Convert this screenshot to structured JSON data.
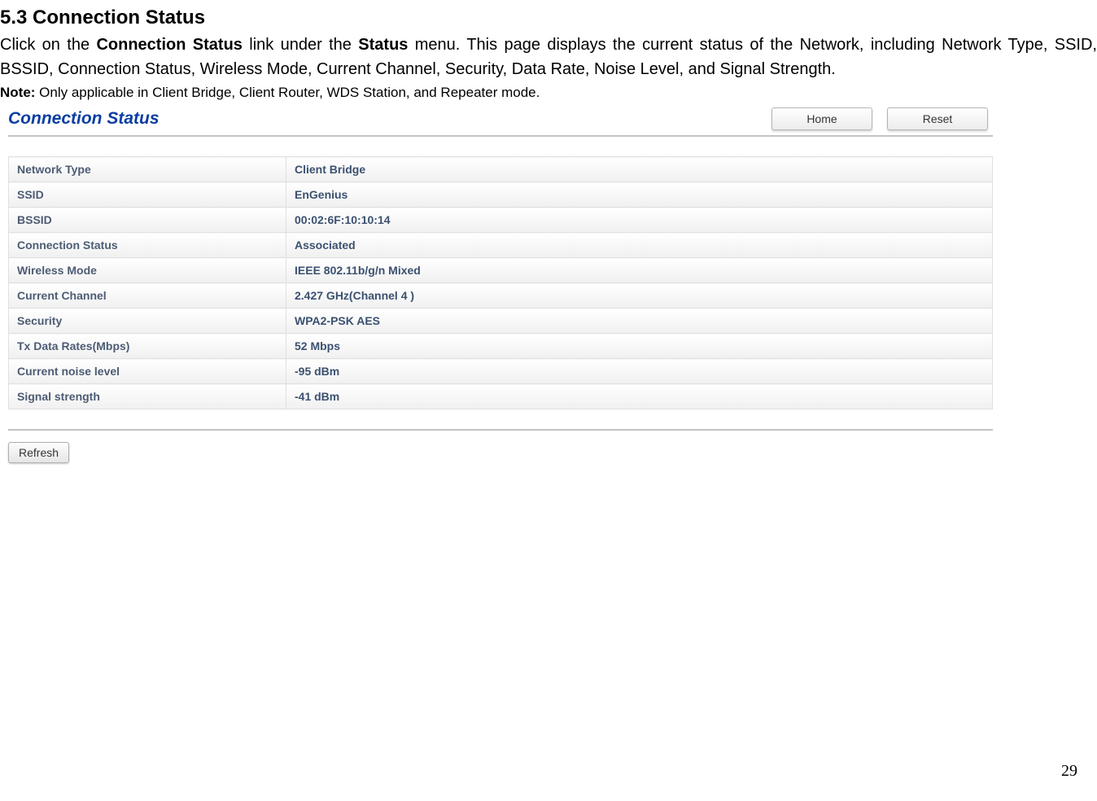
{
  "doc": {
    "section_heading": "5.3   Connection Status",
    "para_parts": {
      "p1a": "Click on the ",
      "p1b": "Connection Status",
      "p1c": " link under the ",
      "p1d": "Status",
      "p1e": " menu. This page displays the current status of the Network, including Network Type, SSID, BSSID, Connection Status, Wireless Mode, Current Channel, Security, Data Rate, Noise Level, and Signal Strength."
    },
    "note_label": "Note:",
    "note_text": " Only applicable in Client Bridge, Client Router, WDS Station, and Repeater mode.",
    "page_number": "29"
  },
  "ui": {
    "title": "Connection Status",
    "buttons": {
      "home": "Home",
      "reset": "Reset"
    },
    "rows": [
      {
        "label": "Network Type",
        "value": "Client Bridge"
      },
      {
        "label": "SSID",
        "value": "EnGenius"
      },
      {
        "label": "BSSID",
        "value": "00:02:6F:10:10:14"
      },
      {
        "label": "Connection Status",
        "value": "Associated"
      },
      {
        "label": "Wireless Mode",
        "value": "IEEE 802.11b/g/n Mixed"
      },
      {
        "label": "Current Channel",
        "value": "2.427 GHz(Channel 4 )"
      },
      {
        "label": "Security",
        "value": "WPA2-PSK AES"
      },
      {
        "label": "Tx Data Rates(Mbps)",
        "value": "52 Mbps"
      },
      {
        "label": "Current noise level",
        "value": "-95 dBm"
      },
      {
        "label": "Signal strength",
        "value": "-41 dBm"
      }
    ],
    "refresh": "Refresh"
  }
}
